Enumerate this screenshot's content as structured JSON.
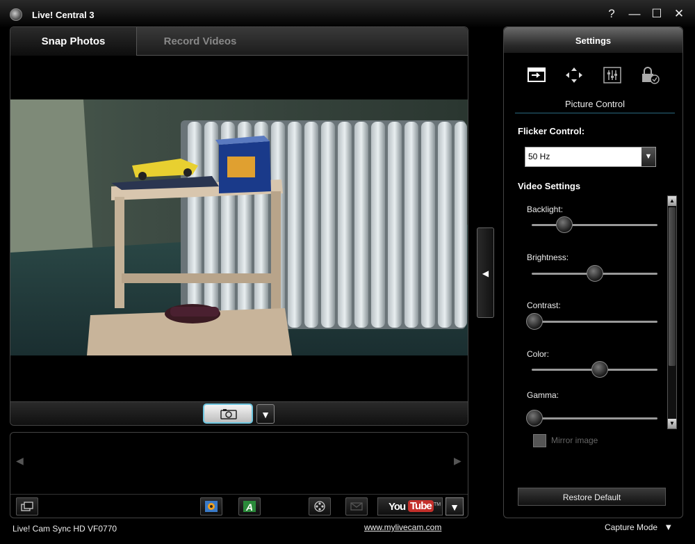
{
  "window": {
    "title": "Live! Central 3",
    "help": "?",
    "minimize": "—",
    "maximize": "☐",
    "close": "✕"
  },
  "tabs": [
    {
      "label": "Snap Photos",
      "active": true
    },
    {
      "label": "Record Videos",
      "active": false
    }
  ],
  "controls": {
    "snap_icon": "camera-icon",
    "dropdown_arrow": "▼"
  },
  "gallery": {
    "prev_arrow": "◀",
    "next_arrow": "▶",
    "tools": [
      "window-icon",
      "photo-app-icon",
      "font-app-icon",
      "film-reel-icon",
      "mail-icon"
    ],
    "youtube": {
      "you": "You",
      "tube": "Tube",
      "tm": "TM"
    },
    "youtube_dropdown": "▼"
  },
  "collapse_arrow": "◀",
  "settings": {
    "header": "Settings",
    "icons": [
      "picture-control-icon",
      "move-icon",
      "equalizer-icon",
      "lock-icon"
    ],
    "section_title": "Picture Control",
    "flicker": {
      "label": "Flicker Control:",
      "value": "50 Hz",
      "arrow": "▼"
    },
    "video_settings_label": "Video Settings",
    "sliders": [
      {
        "label": "Backlight:",
        "value": 0.26
      },
      {
        "label": "Brightness:",
        "value": 0.5
      },
      {
        "label": "Contrast:",
        "value": 0.02
      },
      {
        "label": "Color:",
        "value": 0.54
      },
      {
        "label": "Gamma:",
        "value": 0.02
      }
    ],
    "scroll_up": "▲",
    "scroll_down": "▼",
    "mirror": {
      "label": "Mirror image",
      "checked": false
    },
    "restore_label": "Restore Default"
  },
  "statusbar": {
    "device": "Live! Cam Sync HD VF0770",
    "link": "www.mylivecam.com",
    "mode": "Capture Mode",
    "mode_arrow": "▼"
  }
}
